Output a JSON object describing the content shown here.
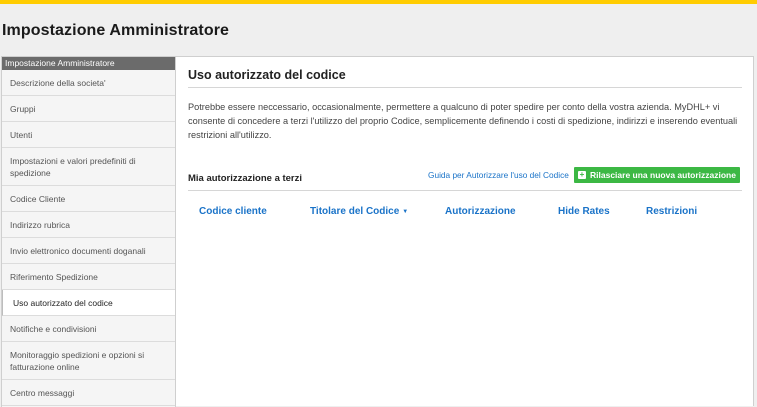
{
  "page": {
    "title": "Impostazione Amministratore"
  },
  "sidebar": {
    "header": "Impostazione Amministratore",
    "items": [
      {
        "label": "Descrizione della societa'"
      },
      {
        "label": "Gruppi"
      },
      {
        "label": "Utenti"
      },
      {
        "label": "Impostazioni e valori predefiniti di spedizione"
      },
      {
        "label": "Codice Cliente"
      },
      {
        "label": "Indirizzo rubrica"
      },
      {
        "label": "Invio elettronico documenti doganali"
      },
      {
        "label": "Riferimento Spedizione"
      },
      {
        "label": "Uso autorizzato del codice",
        "active": true
      },
      {
        "label": "Notifiche e condivisioni"
      },
      {
        "label": "Monitoraggio spedizioni e opzioni si fatturazione online"
      },
      {
        "label": "Centro messaggi"
      }
    ]
  },
  "main": {
    "title": "Uso autorizzato del codice",
    "description": "Potrebbe essere neccessario, occasionalmente, permettere a qualcuno di poter spedire per conto della vostra azienda. MyDHL+ vi consente di concedere a terzi l'utilizzo del proprio Codice, semplicemente definendo i costi di spedizione, indirizzi e inserendo eventuali restrizioni all'utilizzo.",
    "section_title": "Mia autorizzazione a terzi",
    "guide_link": "Guida per Autorizzare l'uso del Codice",
    "add_button": "Rilasciare una nuova autorizzazione",
    "columns": [
      "Codice cliente",
      "Titolare del Codice",
      "Autorizzazione",
      "Hide Rates",
      "Restrizioni"
    ]
  },
  "colors": {
    "accent": "#ffcc00",
    "link": "#1a73c8",
    "button": "#3cb844"
  }
}
